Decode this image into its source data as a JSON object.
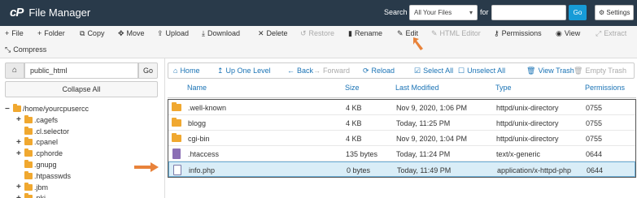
{
  "header": {
    "logo": "cP",
    "title": "File Manager",
    "search_label": "Search",
    "search_scope": "All Your Files",
    "for_label": "for",
    "search_value": "",
    "go_label": "Go",
    "settings_label": "Settings"
  },
  "toolbar": {
    "row1": [
      {
        "icon": "plus-icon",
        "glyph": "+",
        "label": "File",
        "disabled": false
      },
      {
        "icon": "plus-icon",
        "glyph": "+",
        "label": "Folder",
        "disabled": false
      },
      {
        "icon": "copy-icon",
        "glyph": "⧉",
        "label": "Copy",
        "disabled": false
      },
      {
        "icon": "move-icon",
        "glyph": "✥",
        "label": "Move",
        "disabled": false
      },
      {
        "icon": "upload-icon",
        "glyph": "⇪",
        "label": "Upload",
        "disabled": false
      },
      {
        "icon": "download-icon",
        "glyph": "⤓",
        "label": "Download",
        "disabled": false
      },
      {
        "icon": "delete-icon",
        "glyph": "✕",
        "label": "Delete",
        "disabled": false
      },
      {
        "icon": "restore-icon",
        "glyph": "↺",
        "label": "Restore",
        "disabled": true
      },
      {
        "icon": "rename-icon",
        "glyph": "▮",
        "label": "Rename",
        "disabled": false
      },
      {
        "icon": "edit-icon",
        "glyph": "✎",
        "label": "Edit",
        "disabled": false
      },
      {
        "icon": "html-editor-icon",
        "glyph": "✎",
        "label": "HTML Editor",
        "disabled": true
      },
      {
        "icon": "key-icon",
        "glyph": "⚷",
        "label": "Permissions",
        "disabled": false
      },
      {
        "icon": "eye-icon",
        "glyph": "◉",
        "label": "View",
        "disabled": false
      },
      {
        "icon": "extract-icon",
        "glyph": "⤢",
        "label": "Extract",
        "disabled": true
      }
    ],
    "row2": [
      {
        "icon": "compress-icon",
        "glyph": "⤡",
        "label": "Compress",
        "disabled": false
      }
    ]
  },
  "left": {
    "path_value": "public_html",
    "go_label": "Go",
    "collapse_label": "Collapse All",
    "tree": [
      {
        "toggle": "−",
        "label": "/home/yourcpusercc",
        "level": 0
      },
      {
        "toggle": "+",
        "label": ".cagefs",
        "level": 1
      },
      {
        "toggle": "",
        "label": ".cl.selector",
        "level": 1
      },
      {
        "toggle": "+",
        "label": ".cpanel",
        "level": 1
      },
      {
        "toggle": "+",
        "label": ".cphorde",
        "level": 1
      },
      {
        "toggle": "",
        "label": ".gnupg",
        "level": 1
      },
      {
        "toggle": "",
        "label": ".htpasswds",
        "level": 1
      },
      {
        "toggle": "+",
        "label": ".jbm",
        "level": 1
      },
      {
        "toggle": "+",
        "label": ".pki",
        "level": 1
      }
    ]
  },
  "nav": [
    {
      "icon": "home-icon",
      "glyph": "⌂",
      "label": "Home",
      "disabled": false
    },
    {
      "icon": "level-up-icon",
      "glyph": "↥",
      "label": "Up One Level",
      "disabled": false
    },
    {
      "icon": "back-icon",
      "glyph": "←",
      "label": "Back",
      "disabled": false
    },
    {
      "icon": "forward-icon",
      "glyph": "→",
      "label": "Forward",
      "disabled": true
    },
    {
      "icon": "reload-icon",
      "glyph": "⟳",
      "label": "Reload",
      "disabled": false
    },
    {
      "icon": "select-all-icon",
      "glyph": "☑",
      "label": "Select All",
      "disabled": false
    },
    {
      "icon": "unselect-all-icon",
      "glyph": "☐",
      "label": "Unselect All",
      "disabled": false
    },
    {
      "icon": "trash-icon",
      "glyph": "🗑",
      "label": "View Trash",
      "disabled": false
    },
    {
      "icon": "empty-trash-icon",
      "glyph": "🗑",
      "label": "Empty Trash",
      "disabled": true
    }
  ],
  "table": {
    "columns": [
      "Name",
      "Size",
      "Last Modified",
      "Type",
      "Permissions"
    ],
    "rows": [
      {
        "kind": "folder",
        "name": ".well-known",
        "size": "4 KB",
        "modified": "Nov 9, 2020, 1:06 PM",
        "type": "httpd/unix-directory",
        "perms": "0755",
        "selected": false
      },
      {
        "kind": "folder",
        "name": "blogg",
        "size": "4 KB",
        "modified": "Today, 11:25 PM",
        "type": "httpd/unix-directory",
        "perms": "0755",
        "selected": false
      },
      {
        "kind": "folder",
        "name": "cgi-bin",
        "size": "4 KB",
        "modified": "Nov 9, 2020, 1:04 PM",
        "type": "httpd/unix-directory",
        "perms": "0755",
        "selected": false
      },
      {
        "kind": "text",
        "name": ".htaccess",
        "size": "135 bytes",
        "modified": "Today, 11:24 PM",
        "type": "text/x-generic",
        "perms": "0644",
        "selected": false
      },
      {
        "kind": "php",
        "name": "info.php",
        "size": "0 bytes",
        "modified": "Today, 11:49 PM",
        "type": "application/x-httpd-php",
        "perms": "0644",
        "selected": true
      }
    ]
  },
  "colors": {
    "header_bg": "#293a4a",
    "accent_blue": "#179bd7",
    "link_blue": "#1a73b5",
    "arrow_orange": "#e8823a",
    "folder_yellow": "#f0a830",
    "selected_row": "#d9edf7"
  }
}
